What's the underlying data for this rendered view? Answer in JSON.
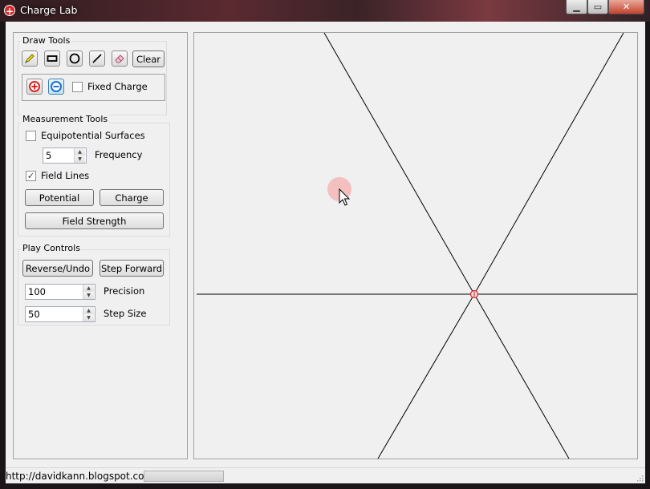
{
  "window": {
    "title": "Charge Lab",
    "icon": "plus-charge-icon",
    "controls": [
      "minimize-icon",
      "maximize-icon",
      "close-icon"
    ]
  },
  "draw_tools": {
    "title": "Draw Tools",
    "tools": [
      "pencil-icon",
      "rectangle-icon",
      "circle-icon",
      "line-icon",
      "eraser-icon"
    ],
    "clear_label": "Clear",
    "charges": [
      "positive-charge-icon",
      "negative-charge-icon"
    ],
    "fixed_charge_label": "Fixed Charge",
    "fixed_charge_checked": false
  },
  "measurement": {
    "title": "Measurement Tools",
    "equipotential_label": "Equipotential Surfaces",
    "equipotential_checked": false,
    "frequency_value": "5",
    "frequency_label": "Frequency",
    "field_lines_label": "Field Lines",
    "field_lines_checked": true,
    "potential_label": "Potential",
    "charge_label": "Charge",
    "field_strength_label": "Field Strength"
  },
  "play": {
    "title": "Play Controls",
    "reverse_label": "Reverse/Undo",
    "step_forward_label": "Step Forward",
    "precision_value": "100",
    "precision_label": "Precision",
    "step_size_value": "50",
    "step_size_label": "Step Size"
  },
  "status": {
    "url": "http://davidkann.blogspot.com",
    "progress": 0.0
  },
  "colors": {
    "positive_charge": "#d62828",
    "negative_charge": "#1e6fd0",
    "cursor_highlight": "#f4b6b6"
  }
}
